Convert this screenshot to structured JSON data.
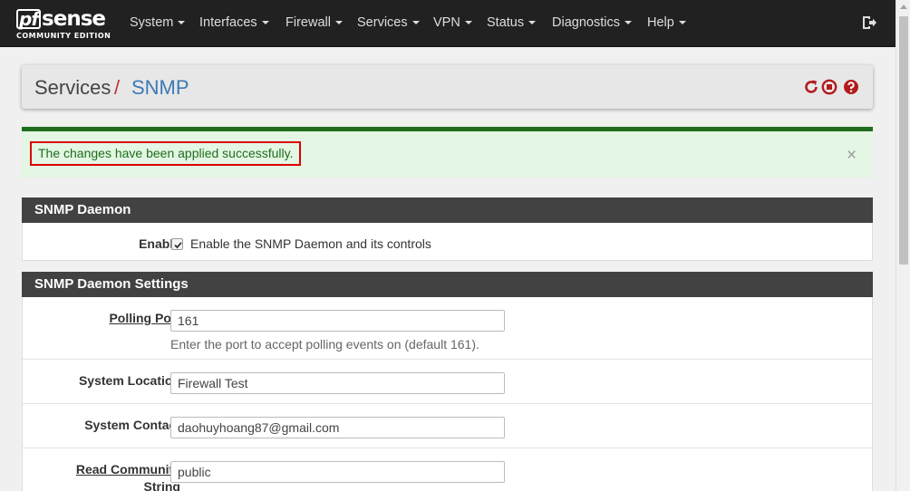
{
  "nav": {
    "brand": {
      "logo_mark": "pf",
      "logo_text": "sense",
      "edition": "COMMUNITY EDITION"
    },
    "items": [
      {
        "label": "System"
      },
      {
        "label": "Interfaces"
      },
      {
        "label": "Firewall"
      },
      {
        "label": "Services"
      },
      {
        "label": "VPN"
      },
      {
        "label": "Status"
      },
      {
        "label": "Diagnostics"
      },
      {
        "label": "Help"
      }
    ],
    "logout_icon": "logout-icon"
  },
  "breadcrumb": {
    "section": "Services",
    "separator": "/",
    "page": "SNMP"
  },
  "header_icons": [
    "restart-icon",
    "stop-icon",
    "help-icon"
  ],
  "alert": {
    "message": "The changes have been applied successfully.",
    "close": "×"
  },
  "snmp_daemon": {
    "title": "SNMP Daemon",
    "enable_label": "Enable",
    "enable_checked": true,
    "enable_text": "Enable the SNMP Daemon and its controls"
  },
  "settings": {
    "title": "SNMP Daemon Settings",
    "polling_port": {
      "label": "Polling Port",
      "value": "161",
      "help": "Enter the port to accept polling events on (default 161)."
    },
    "system_location": {
      "label": "System Location",
      "value": "Firewall Test"
    },
    "system_contact": {
      "label": "System Contact",
      "value": "daohuyhoang87@gmail.com"
    },
    "read_community": {
      "label_line1": "Read Community",
      "label_line2": "String",
      "value": "public"
    }
  },
  "colors": {
    "navbar": "#212121",
    "panel_title": "#424242",
    "link_blue": "#3c7ab5",
    "success_green": "#1e6e1e",
    "alert_bg": "#e4f6e4",
    "highlight_red": "#dd0000",
    "icon_red": "#b31b1b"
  }
}
